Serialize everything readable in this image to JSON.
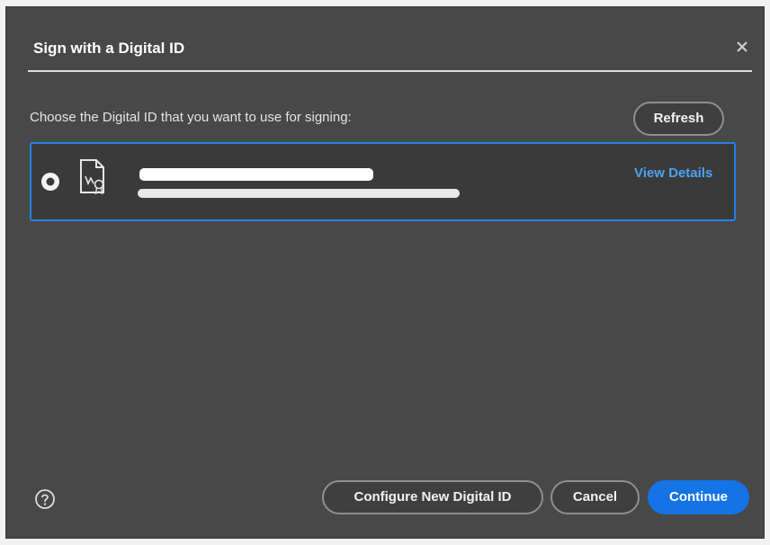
{
  "dialog": {
    "title": "Sign with a Digital ID",
    "close_icon": "close-icon",
    "prompt": "Choose the Digital ID that you want to use for signing:",
    "refresh_label": "Refresh"
  },
  "digital_ids": [
    {
      "name": "",
      "issuer": "",
      "selected": true,
      "view_details_label": "View Details"
    }
  ],
  "footer": {
    "help_icon": "help-icon",
    "configure_label": "Configure New Digital ID",
    "cancel_label": "Cancel",
    "continue_label": "Continue"
  },
  "colors": {
    "dialog_bg": "#484848",
    "accent": "#1473e6",
    "link": "#4ba3f5",
    "selection_border": "#2680eb"
  }
}
